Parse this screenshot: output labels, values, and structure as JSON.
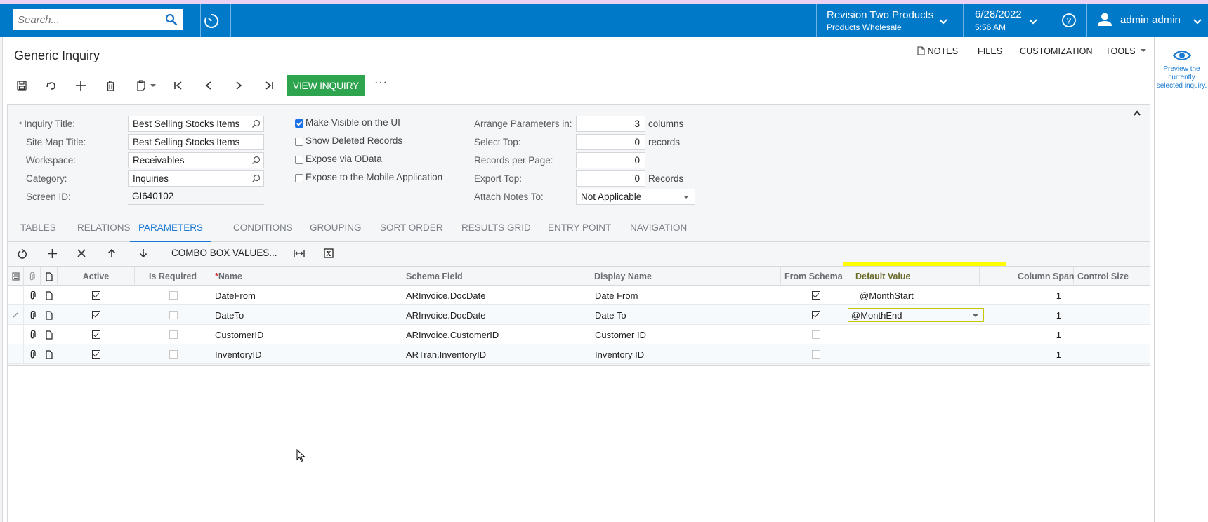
{
  "header": {
    "search_placeholder": "Search...",
    "company_name": "Revision Two Products",
    "branch_name": "Products Wholesale",
    "date": "6/28/2022",
    "time": "5:56 AM",
    "user_name": "admin admin",
    "brand_color": "#0079c9"
  },
  "page": {
    "title": "Generic Inquiry",
    "actions": {
      "notes": "NOTES",
      "files": "FILES",
      "customization": "CUSTOMIZATION",
      "tools": "TOOLS"
    }
  },
  "toolbar": {
    "view_inquiry_label": "VIEW INQUIRY",
    "more_label": "···",
    "view_inquiry_color": "#2ea44f"
  },
  "right_panel": {
    "preview_text": "Preview the currently selected inquiry."
  },
  "form": {
    "inquiry_title_label": "Inquiry Title:",
    "inquiry_title_value": "Best Selling Stocks Items",
    "site_map_title_label": "Site Map Title:",
    "site_map_title_value": "Best Selling Stocks Items",
    "workspace_label": "Workspace:",
    "workspace_value": "Receivables",
    "category_label": "Category:",
    "category_value": "Inquiries",
    "screen_id_label": "Screen ID:",
    "screen_id_value": "GI640102",
    "checkboxes": [
      {
        "label": "Make Visible on the UI",
        "checked": true
      },
      {
        "label": "Show Deleted Records",
        "checked": false
      },
      {
        "label": "Expose via OData",
        "checked": false
      },
      {
        "label": "Expose to the Mobile Application",
        "checked": false
      }
    ],
    "arrange_label": "Arrange Parameters in:",
    "arrange_value": "3",
    "arrange_suffix": "columns",
    "select_top_label": "Select Top:",
    "select_top_value": "0",
    "select_top_suffix": "records",
    "records_per_page_label": "Records per Page:",
    "records_per_page_value": "0",
    "export_top_label": "Export Top:",
    "export_top_value": "0",
    "export_top_suffix": "Records",
    "attach_notes_label": "Attach Notes To:",
    "attach_notes_value": "Not Applicable"
  },
  "tabs": [
    {
      "label": "TABLES",
      "active": false
    },
    {
      "label": "RELATIONS",
      "active": false
    },
    {
      "label": "PARAMETERS",
      "active": true
    },
    {
      "label": "CONDITIONS",
      "active": false
    },
    {
      "label": "GROUPING",
      "active": false
    },
    {
      "label": "SORT ORDER",
      "active": false
    },
    {
      "label": "RESULTS GRID",
      "active": false
    },
    {
      "label": "ENTRY POINT",
      "active": false
    },
    {
      "label": "NAVIGATION",
      "active": false
    }
  ],
  "grid_toolbar": {
    "combo_box_values_label": "COMBO BOX VALUES..."
  },
  "grid": {
    "columns": {
      "active": "Active",
      "is_required": "Is Required",
      "name": "Name",
      "schema_field": "Schema Field",
      "display_name": "Display Name",
      "from_schema": "From Schema",
      "default_value": "Default Value",
      "column_span": "Column Span",
      "control_size": "Control Size"
    },
    "rows": [
      {
        "active": true,
        "is_required": false,
        "name": "DateFrom",
        "schema_field": "ARInvoice.DocDate",
        "display_name": "Date From",
        "from_schema": true,
        "default_value": "@MonthStart",
        "column_span": "1",
        "control_size": "",
        "editing": false
      },
      {
        "active": true,
        "is_required": false,
        "name": "DateTo",
        "schema_field": "ARInvoice.DocDate",
        "display_name": "Date To",
        "from_schema": true,
        "default_value": "@MonthEnd",
        "column_span": "1",
        "control_size": "",
        "editing": true
      },
      {
        "active": true,
        "is_required": false,
        "name": "CustomerID",
        "schema_field": "ARInvoice.CustomerID",
        "display_name": "Customer ID",
        "from_schema": false,
        "default_value": "",
        "column_span": "1",
        "control_size": "",
        "editing": false
      },
      {
        "active": true,
        "is_required": false,
        "name": "InventoryID",
        "schema_field": "ARTran.InventoryID",
        "display_name": "Inventory ID",
        "from_schema": false,
        "default_value": "",
        "column_span": "1",
        "control_size": "",
        "editing": false
      }
    ],
    "highlight_color": "#ffff00"
  }
}
